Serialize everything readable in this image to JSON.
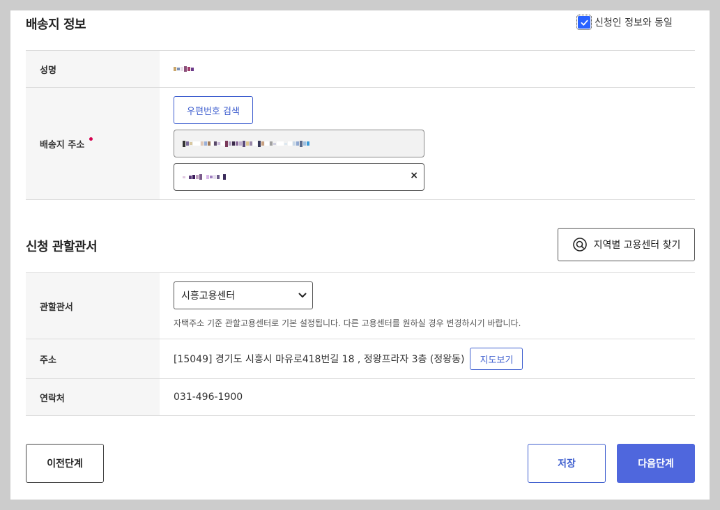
{
  "shipping": {
    "title": "배송지 정보",
    "same_as_applicant_label": "신청인 정보와 동일",
    "same_as_applicant_checked": true,
    "name_label": "성명",
    "address_label": "배송지 주소",
    "zip_search_label": "우편번호 검색",
    "clear_icon": "×"
  },
  "office": {
    "title": "신청 관할관서",
    "region_search_label": "지역별 고용센터 찾기",
    "office_label": "관할관서",
    "office_selected": "시흥고용센터",
    "office_hint": "자택주소 기준 관할고용센터로 기본 설정됩니다. 다른 고용센터를 원하실 경우 변경하시기 바랍니다.",
    "address_label": "주소",
    "address_value": "[15049] 경기도 시흥시 마유로418번길 18 , 정왕프라자 3층 (정왕동)",
    "map_button_label": "지도보기",
    "phone_label": "연락처",
    "phone_value": "031-496-1900"
  },
  "footer": {
    "prev_label": "이전단계",
    "save_label": "저장",
    "next_label": "다음단계"
  },
  "colors": {
    "primary": "#4f67dd",
    "required_dot": "#d4004f",
    "checkbox": "#2962ff"
  }
}
